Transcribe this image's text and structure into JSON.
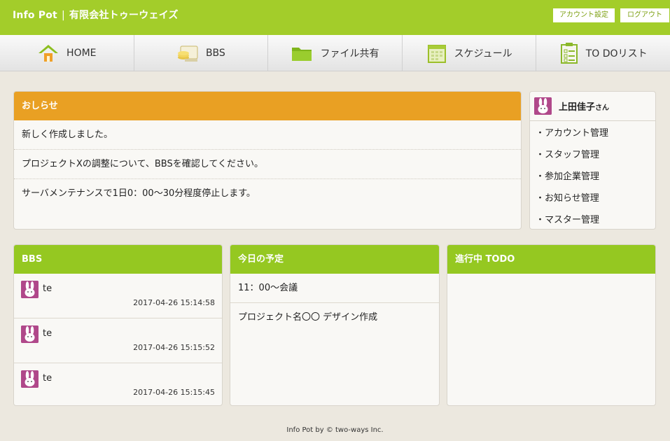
{
  "header": {
    "app_name": "Info Pot",
    "separator": "|",
    "company": "有限会社トゥーウェイズ",
    "account_settings_label": "アカウント設定",
    "logout_label": "ログアウト"
  },
  "nav": {
    "items": [
      {
        "label": "HOME",
        "icon": "home-icon"
      },
      {
        "label": "BBS",
        "icon": "bbs-icon"
      },
      {
        "label": "ファイル共有",
        "icon": "folder-icon"
      },
      {
        "label": "スケジュール",
        "icon": "calendar-icon"
      },
      {
        "label": "TO DOリスト",
        "icon": "checklist-icon"
      }
    ]
  },
  "notice": {
    "title": "おしらせ",
    "items": [
      "新しく作成しました。",
      "プロジェクトXの調整について、BBSを確認してください。",
      "サーバメンテナンスで1日0：00〜30分程度停止します。"
    ]
  },
  "profile": {
    "name": "上田佳子",
    "honorific": "さん",
    "menu": [
      "・アカウント管理",
      "・スタッフ管理",
      "・参加企業管理",
      "・お知らせ管理",
      "・マスター管理"
    ]
  },
  "bbs": {
    "title": "BBS",
    "posts": [
      {
        "name": "te",
        "date": "2017-04-26 15:14:58"
      },
      {
        "name": "te",
        "date": "2017-04-26 15:15:52"
      },
      {
        "name": "te",
        "date": "2017-04-26 15:15:45"
      }
    ]
  },
  "schedule": {
    "title": "今日の予定",
    "items": [
      "11：00〜会議",
      "プロジェクト名〇〇 デザイン作成"
    ]
  },
  "todo": {
    "title": "進行中 TODO"
  },
  "footer": {
    "text": "Info Pot by © two-ways Inc."
  },
  "colors": {
    "brand_green": "#a3cd2a",
    "panel_green": "#95c821",
    "notice_orange": "#e9a023",
    "avatar_pink": "#b0488a",
    "background": "#ece8df"
  }
}
